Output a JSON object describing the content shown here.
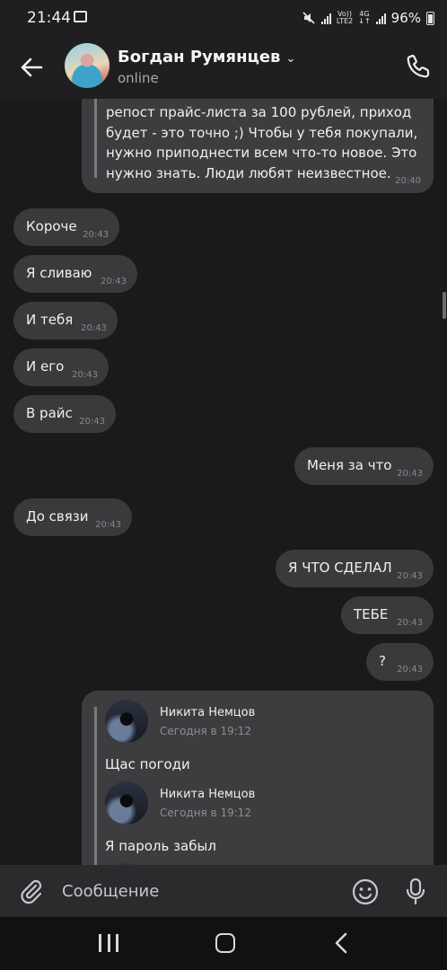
{
  "status_bar": {
    "time": "21:44",
    "net_top": "Vo))",
    "net_bottom": "LTE2",
    "net2_top": "4G",
    "net2_bottom": "↓↑",
    "battery": "96%"
  },
  "header": {
    "contact_name": "Богдан Румянцев",
    "status": "online"
  },
  "messages": [
    {
      "side": "out",
      "lines": [
        "репост прайс-листа за 100 рублей, приход",
        "будет - это точно ;) Чтобы у тебя покупали,",
        "нужно приподнести всем что-то новое. Это",
        "нужно знать. Люди любят неизвестное."
      ],
      "time": "20:40"
    },
    {
      "side": "in",
      "text": "Короче",
      "time": "20:43"
    },
    {
      "side": "in",
      "text": "Я сливаю",
      "time": "20:43"
    },
    {
      "side": "in",
      "text": "И тебя",
      "time": "20:43"
    },
    {
      "side": "in",
      "text": "И его",
      "time": "20:43"
    },
    {
      "side": "in",
      "text": "В райс",
      "time": "20:43"
    },
    {
      "side": "out",
      "text": "Меня за что",
      "time": "20:43"
    },
    {
      "side": "in",
      "text": "До связи",
      "time": "20:43"
    },
    {
      "side": "out",
      "text": "Я ЧТО СДЕЛАЛ",
      "time": "20:43"
    },
    {
      "side": "out",
      "text": "ТЕБЕ",
      "time": "20:43"
    },
    {
      "side": "out",
      "text": "?",
      "time": "20:43"
    }
  ],
  "forwarded": [
    {
      "author": "Никита Немцов",
      "date": "Сегодня в 19:12",
      "text": "Щас погоди"
    },
    {
      "author": "Никита Немцов",
      "date": "Сегодня в 19:12",
      "text": "Я пароль забыл"
    }
  ],
  "input": {
    "placeholder": "Сообщение"
  },
  "colors": {
    "background": "#1a1a1c",
    "bubble": "#3a3a3d",
    "text": "#f0f0f0",
    "timestamp": "#88888c"
  },
  "icons": [
    "back-arrow-icon",
    "chevron-down-icon",
    "phone-icon",
    "paperclip-icon",
    "emoji-icon",
    "microphone-icon",
    "gallery-icon",
    "mute-icon",
    "signal-icon",
    "battery-icon"
  ]
}
